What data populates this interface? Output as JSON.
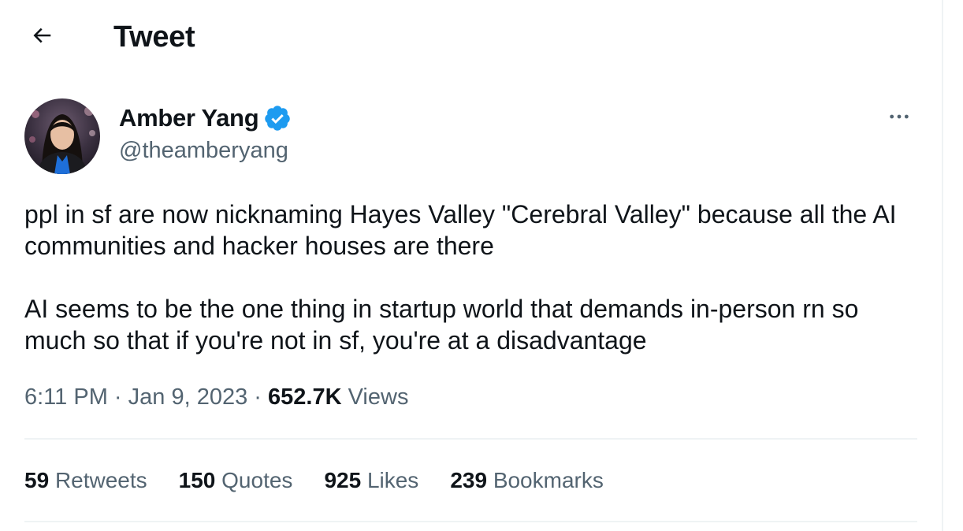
{
  "header": {
    "title": "Tweet",
    "back_icon": "arrow-left-icon"
  },
  "author": {
    "display_name": "Amber Yang",
    "handle": "@theamberyang",
    "verified_icon": "verified-badge-icon",
    "verified_color": "#1d9bf0"
  },
  "tweet": {
    "paragraphs": [
      "ppl in sf are now nicknaming Hayes Valley \"Cerebral Valley\" because all the AI communities and hacker houses are there",
      "AI seems to be the one thing in startup world that demands in-person rn so much so that if you're not in sf, you're at a disadvantage"
    ],
    "time": "6:11 PM",
    "date": "Jan 9, 2023",
    "views_count": "652.7K",
    "views_label": "Views",
    "separator": "·"
  },
  "stats": [
    {
      "count": "59",
      "label": "Retweets"
    },
    {
      "count": "150",
      "label": "Quotes"
    },
    {
      "count": "925",
      "label": "Likes"
    },
    {
      "count": "239",
      "label": "Bookmarks"
    }
  ],
  "more_icon": "more-horizontal-icon",
  "colors": {
    "text_primary": "#0f1419",
    "text_secondary": "#536471",
    "divider": "#eff3f4",
    "accent": "#1d9bf0"
  }
}
